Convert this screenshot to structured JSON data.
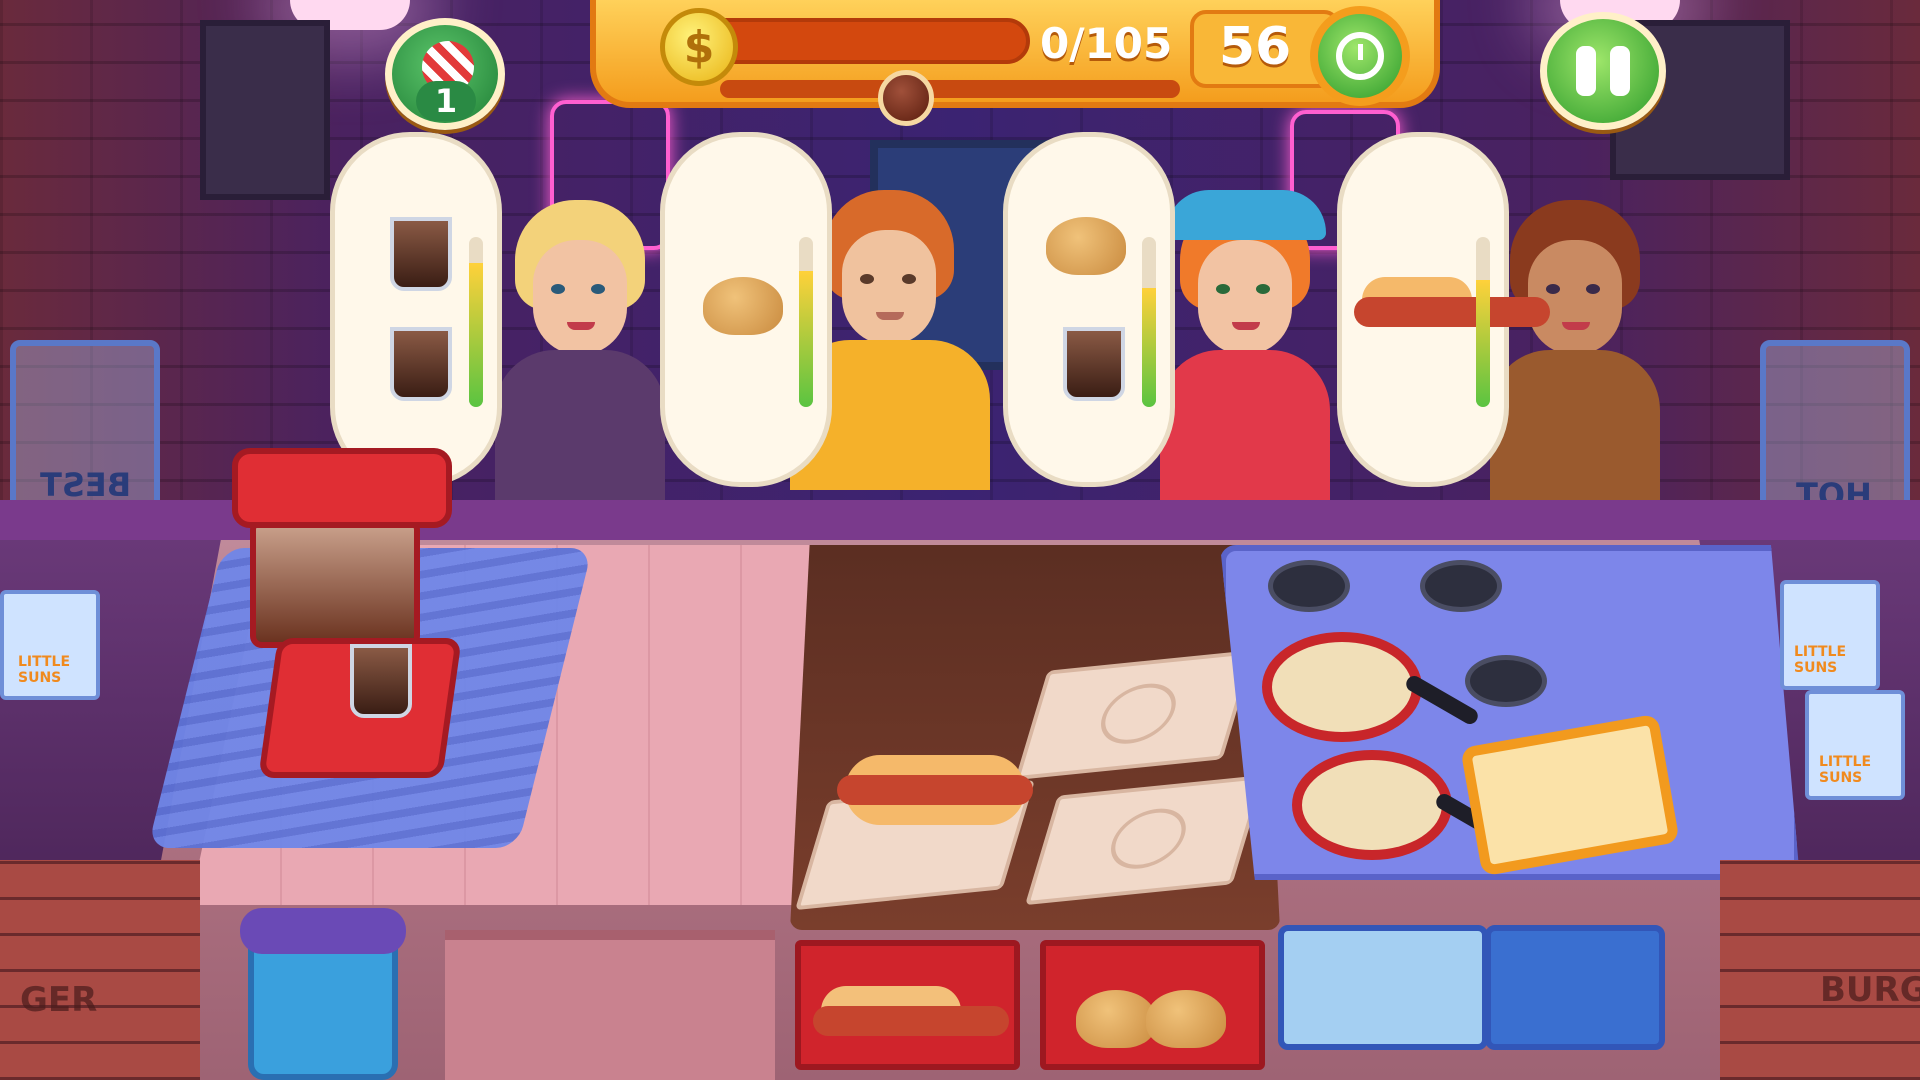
{
  "hud": {
    "coins_collected": "0/105",
    "coin_symbol": "$",
    "timer": "56",
    "gift_count": "1",
    "progress_fraction": 0.0
  },
  "orders": [
    {
      "customer": "blonde-woman",
      "items": [
        "cola",
        "cola"
      ],
      "patience": 0.85
    },
    {
      "customer": "orange-hoodie-man",
      "items": [
        "burger"
      ],
      "patience": 0.8
    },
    {
      "customer": "red-hat-woman",
      "items": [
        "burger",
        "cola"
      ],
      "patience": 0.7
    },
    {
      "customer": "curly-hair-woman",
      "items": [
        "hotdog"
      ],
      "patience": 0.75
    }
  ],
  "decor": {
    "left_sign": "BEST",
    "right_sign": "HOT",
    "box_label": "LITTLE SUNS",
    "left_front": "GER",
    "right_front": "BURG"
  },
  "colors": {
    "accent": "#f49d1d",
    "go_green": "#2b9a2a",
    "brand_red": "#e02e34"
  }
}
